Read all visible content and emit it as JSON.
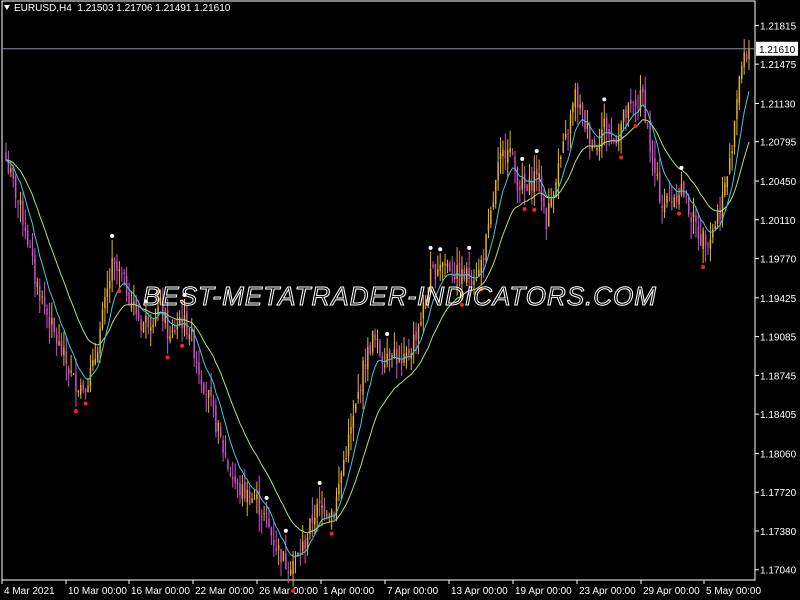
{
  "header": {
    "symbol": "EURUSD,H4",
    "open": "1.21503",
    "high": "1.21706",
    "low": "1.21491",
    "close": "1.21610"
  },
  "watermark": "BEST-METATRADER-INDICATORS.COM",
  "colors": {
    "background": "#000000",
    "bull_candle": "#e6b422",
    "bear_candle": "#d050d0",
    "fast_ma": "#40c8e0",
    "slow_ma": "#b4e070",
    "current_price_line": "#8a8ab0",
    "arrow_up_marker": "#ffffff",
    "arrow_down_marker": "#ff2020"
  },
  "chart_data": {
    "type": "candlestick",
    "symbol": "EURUSD",
    "timeframe": "H4",
    "current_price": 1.2161,
    "current_price_label": "1.21610",
    "ylim": [
      1.1695,
      1.2195
    ],
    "y_ticks": [
      "1.21815",
      "1.21475",
      "1.21130",
      "1.20795",
      "1.20450",
      "1.20110",
      "1.19770",
      "1.19425",
      "1.19085",
      "1.18745",
      "1.18405",
      "1.18060",
      "1.17720",
      "1.17380",
      "1.17040"
    ],
    "x_ticks": [
      "4 Mar 2021",
      "10 Mar 00:00",
      "16 Mar 00:00",
      "22 Mar 00:00",
      "26 Mar 00:00",
      "1 Apr 00:00",
      "7 Apr 00:00",
      "13 Apr 00:00",
      "19 Apr 00:00",
      "23 Apr 00:00",
      "29 Apr 00:00",
      "5 May 00:00"
    ],
    "close_path": [
      [
        0,
        1.2064
      ],
      [
        4,
        1.2035
      ],
      [
        8,
        1.2005
      ],
      [
        12,
        1.196
      ],
      [
        16,
        1.1935
      ],
      [
        20,
        1.191
      ],
      [
        24,
        1.189
      ],
      [
        28,
        1.187
      ],
      [
        32,
        1.1865
      ],
      [
        36,
        1.188
      ],
      [
        40,
        1.1925
      ],
      [
        44,
        1.197
      ],
      [
        48,
        1.196
      ],
      [
        52,
        1.194
      ],
      [
        56,
        1.192
      ],
      [
        60,
        1.1925
      ],
      [
        64,
        1.1935
      ],
      [
        68,
        1.1905
      ],
      [
        72,
        1.1925
      ],
      [
        76,
        1.1915
      ],
      [
        80,
        1.188
      ],
      [
        84,
        1.1855
      ],
      [
        88,
        1.1825
      ],
      [
        92,
        1.1795
      ],
      [
        96,
        1.1775
      ],
      [
        100,
        1.177
      ],
      [
        104,
        1.1765
      ],
      [
        108,
        1.1745
      ],
      [
        112,
        1.1725
      ],
      [
        116,
        1.171
      ],
      [
        120,
        1.1712
      ],
      [
        124,
        1.1728
      ],
      [
        128,
        1.1755
      ],
      [
        132,
        1.176
      ],
      [
        136,
        1.1755
      ],
      [
        140,
        1.18
      ],
      [
        144,
        1.1835
      ],
      [
        148,
        1.188
      ],
      [
        152,
        1.1908
      ],
      [
        156,
        1.189
      ],
      [
        160,
        1.19
      ],
      [
        164,
        1.188
      ],
      [
        168,
        1.19
      ],
      [
        172,
        1.1925
      ],
      [
        176,
        1.196
      ],
      [
        180,
        1.1975
      ],
      [
        184,
        1.197
      ],
      [
        188,
        1.196
      ],
      [
        192,
        1.1962
      ],
      [
        196,
        1.1965
      ],
      [
        200,
        1.2
      ],
      [
        204,
        1.2055
      ],
      [
        208,
        1.208
      ],
      [
        212,
        1.2045
      ],
      [
        216,
        1.2035
      ],
      [
        220,
        1.2055
      ],
      [
        224,
        1.201
      ],
      [
        228,
        1.205
      ],
      [
        232,
        1.208
      ],
      [
        236,
        1.212
      ],
      [
        240,
        1.2095
      ],
      [
        244,
        1.2075
      ],
      [
        248,
        1.2095
      ],
      [
        252,
        1.208
      ],
      [
        256,
        1.21
      ],
      [
        260,
        1.211
      ],
      [
        264,
        1.212
      ],
      [
        268,
        1.206
      ],
      [
        272,
        1.2025
      ],
      [
        276,
        1.203
      ],
      [
        280,
        1.204
      ],
      [
        284,
        1.2015
      ],
      [
        288,
        1.1995
      ],
      [
        292,
        1.1998
      ],
      [
        296,
        1.202
      ],
      [
        300,
        1.206
      ],
      [
        304,
        1.214
      ],
      [
        308,
        1.2161
      ]
    ]
  }
}
